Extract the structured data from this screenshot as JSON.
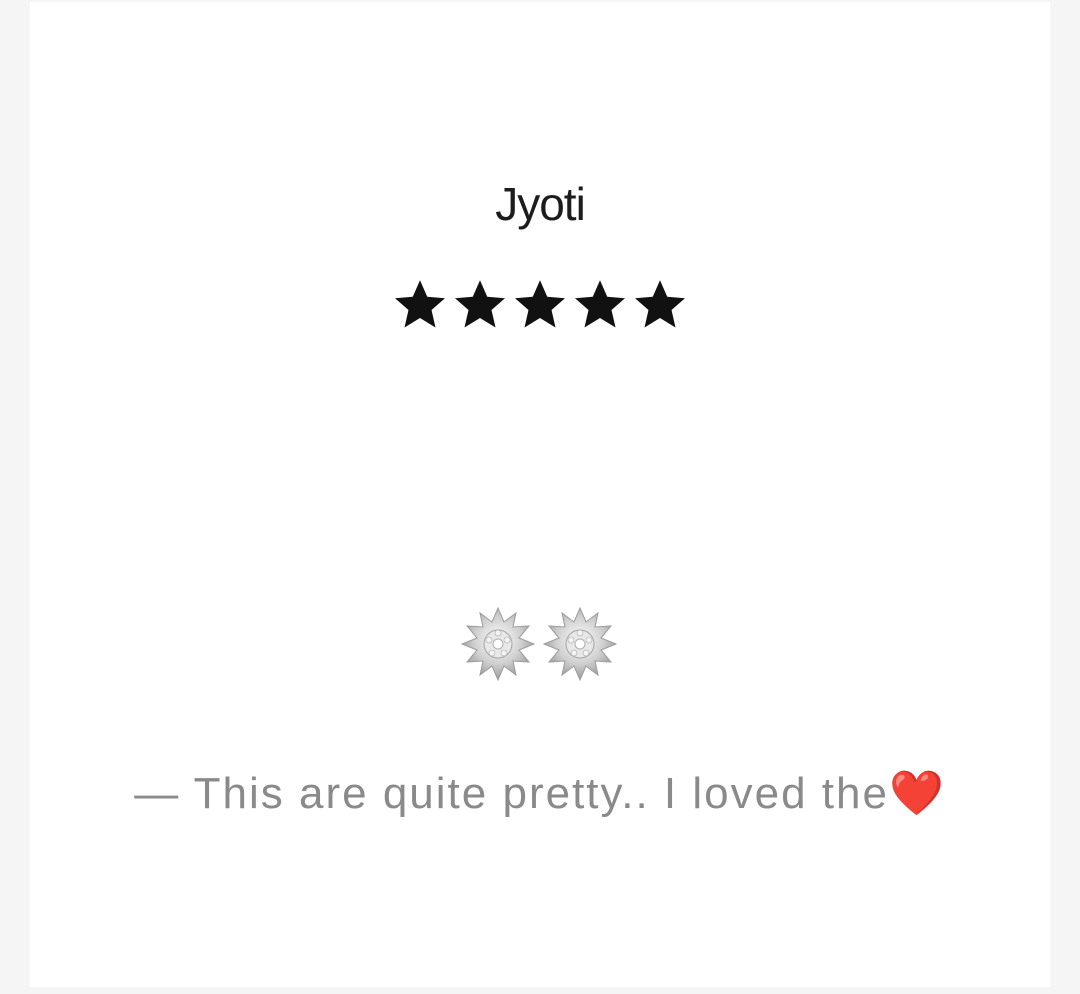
{
  "review": {
    "name": "Jyoti",
    "rating": 5,
    "rating_max": 5,
    "star_color": "#111111",
    "quote_dash": "—",
    "quote_text": "This are quite pretty.. I loved the",
    "quote_emoji": "❤️",
    "image_icon": "star-burst-earrings-icon"
  }
}
